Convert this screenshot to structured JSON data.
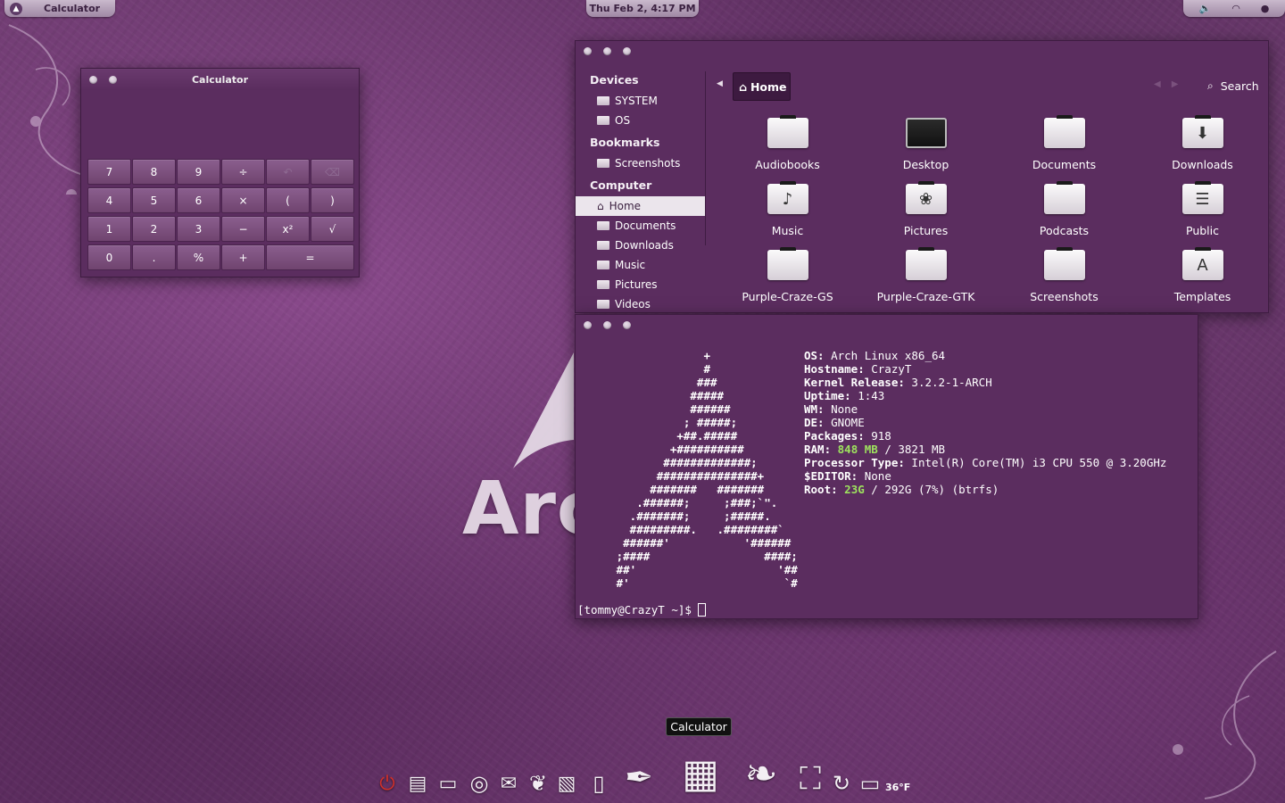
{
  "panel": {
    "app_name": "Calculator",
    "clock": "Thu Feb  2,  4:17 PM"
  },
  "wallpaper": {
    "brand_text": "Arc"
  },
  "calculator": {
    "title": "Calculator",
    "keys": [
      {
        "label": "7",
        "dim": false
      },
      {
        "label": "8",
        "dim": false
      },
      {
        "label": "9",
        "dim": false
      },
      {
        "label": "÷",
        "dim": false
      },
      {
        "label": "undo",
        "dim": true
      },
      {
        "label": "backspace",
        "dim": true
      },
      {
        "label": "4",
        "dim": false
      },
      {
        "label": "5",
        "dim": false
      },
      {
        "label": "6",
        "dim": false
      },
      {
        "label": "×",
        "dim": false
      },
      {
        "label": "(",
        "dim": false
      },
      {
        "label": ")",
        "dim": false
      },
      {
        "label": "1",
        "dim": false
      },
      {
        "label": "2",
        "dim": false
      },
      {
        "label": "3",
        "dim": false
      },
      {
        "label": "−",
        "dim": false
      },
      {
        "label": "x²",
        "dim": false
      },
      {
        "label": "√",
        "dim": false
      },
      {
        "label": "0",
        "dim": false
      },
      {
        "label": ".",
        "dim": false
      },
      {
        "label": "%",
        "dim": false
      },
      {
        "label": "+",
        "dim": false
      },
      {
        "label": "=",
        "dim": false,
        "wide": true
      }
    ]
  },
  "file_manager": {
    "sidebar": {
      "devices_heading": "Devices",
      "devices": [
        "SYSTEM",
        "OS"
      ],
      "bookmarks_heading": "Bookmarks",
      "bookmarks": [
        "Screenshots"
      ],
      "computer_heading": "Computer",
      "computer": [
        "Home",
        "Documents",
        "Downloads",
        "Music",
        "Pictures",
        "Videos"
      ],
      "selected": "Home"
    },
    "location": "Home",
    "search_label": "Search",
    "items": [
      {
        "name": "Audiobooks",
        "icon": "folder-icon"
      },
      {
        "name": "Desktop",
        "icon": "monitor-icon"
      },
      {
        "name": "Documents",
        "icon": "folder-icon"
      },
      {
        "name": "Downloads",
        "icon": "download-folder-icon"
      },
      {
        "name": "Music",
        "icon": "music-folder-icon"
      },
      {
        "name": "Pictures",
        "icon": "pictures-folder-icon"
      },
      {
        "name": "Podcasts",
        "icon": "folder-icon"
      },
      {
        "name": "Public",
        "icon": "public-folder-icon"
      },
      {
        "name": "Purple-Craze-GS",
        "icon": "folder-icon"
      },
      {
        "name": "Purple-Craze-GTK",
        "icon": "folder-icon"
      },
      {
        "name": "Screenshots",
        "icon": "folder-icon"
      },
      {
        "name": "Templates",
        "icon": "templates-folder-icon"
      }
    ]
  },
  "terminal": {
    "ascii_art": "                  +\n                  #\n                 ###\n                #####\n                ######\n               ; #####;\n              +##.#####\n             +##########\n            #############;\n           ###############+\n          #######   #######\n        .######;     ;###;`\".\n       .#######;     ;#####.\n       #########.   .########`\n      ######'           '######\n     ;####                 ####;\n     ##'                     '##\n     #'                       `#",
    "info": [
      {
        "key": "OS:",
        "value": " Arch Linux x86_64",
        "accent": "",
        "rest": ""
      },
      {
        "key": "Hostname:",
        "value": " CrazyT",
        "accent": "",
        "rest": ""
      },
      {
        "key": "Kernel Release:",
        "value": " 3.2.2-1-ARCH",
        "accent": "",
        "rest": ""
      },
      {
        "key": "Uptime:",
        "value": " 1:43",
        "accent": "",
        "rest": ""
      },
      {
        "key": "WM:",
        "value": " None",
        "accent": "",
        "rest": ""
      },
      {
        "key": "DE:",
        "value": " GNOME",
        "accent": "",
        "rest": ""
      },
      {
        "key": "Packages:",
        "value": " 918",
        "accent": "",
        "rest": ""
      },
      {
        "key": "RAM:",
        "value": " ",
        "accent": "848 MB",
        "rest": " / 3821 MB"
      },
      {
        "key": "Processor Type:",
        "value": " Intel(R) Core(TM) i3 CPU 550 @ 3.20GHz",
        "accent": "",
        "rest": ""
      },
      {
        "key": "$EDITOR:",
        "value": " None",
        "accent": "",
        "rest": ""
      },
      {
        "key": "Root:",
        "value": " ",
        "accent": "23G",
        "rest": " / 292G (7%) (btrfs)"
      }
    ],
    "prompt": "[tommy@CrazyT ~]$ "
  },
  "dock": {
    "tooltip": "Calculator",
    "weather": "36°F",
    "icons": [
      {
        "name": "power-icon",
        "glyph": "⏻",
        "color": "#d0302a"
      },
      {
        "name": "files-icon",
        "glyph": "▤",
        "color": "#f3eef3"
      },
      {
        "name": "terminal-icon",
        "glyph": "▭",
        "color": "#f3eef3"
      },
      {
        "name": "chrome-icon",
        "glyph": "◎",
        "color": "#f3eef3"
      },
      {
        "name": "mail-icon",
        "glyph": "✉",
        "color": "#f3eef3"
      },
      {
        "name": "pidgin-icon",
        "glyph": "❦",
        "color": "#f3eef3"
      },
      {
        "name": "image-viewer-icon",
        "glyph": "▧",
        "color": "#f3eef3"
      },
      {
        "name": "text-editor-icon",
        "glyph": "▯",
        "color": "#f3eef3"
      },
      {
        "name": "pen-icon",
        "glyph": "✒",
        "color": "#f3eef3"
      },
      {
        "name": "calculator-icon",
        "glyph": "▦",
        "color": "#f3eef3"
      },
      {
        "name": "gimp-icon",
        "glyph": "❧",
        "color": "#f3eef3"
      },
      {
        "name": "network-icon",
        "glyph": "⛶",
        "color": "#f3eef3"
      },
      {
        "name": "updater-icon",
        "glyph": "↻",
        "color": "#f3eef3"
      },
      {
        "name": "display-icon",
        "glyph": "▭",
        "color": "#f3eef3"
      }
    ]
  }
}
